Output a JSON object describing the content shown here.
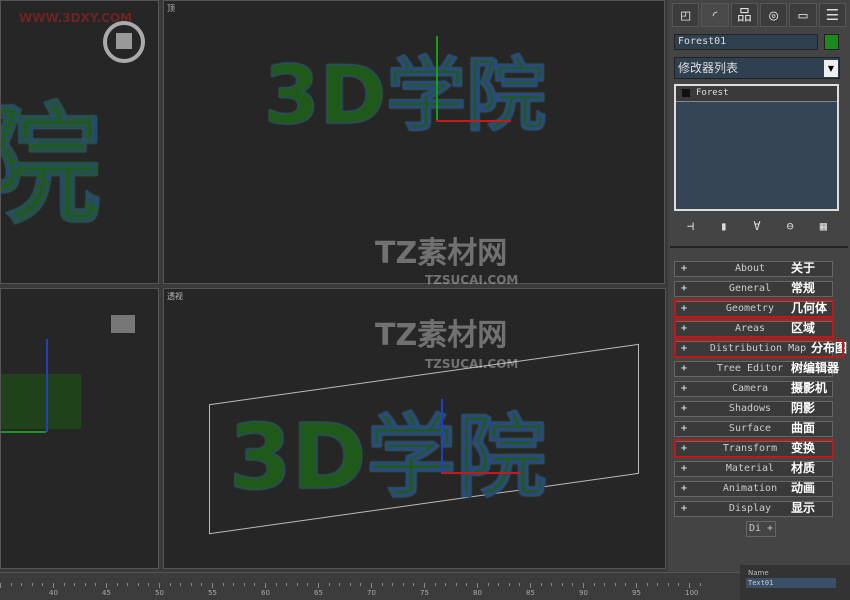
{
  "viewports": {
    "top_left": {
      "label": "",
      "watermark": "WWW.3DXY.COM",
      "text": "院"
    },
    "top": {
      "label": "顶",
      "text": "3D学院"
    },
    "left": {
      "label": ""
    },
    "perspective": {
      "label": "透视",
      "text": "3D学院"
    },
    "overlay_watermark": {
      "brand": "TZ素材网",
      "url": "TZSUCAI.COM"
    }
  },
  "panel": {
    "tabs": [
      "create-icon",
      "modify-icon",
      "hierarchy-icon",
      "motion-icon",
      "display-icon",
      "utilities-icon"
    ],
    "object_name": "Forest01",
    "object_color": "#1a8a1a",
    "modifier_list": "修改器列表",
    "stack": [
      "Forest"
    ],
    "rollouts": [
      {
        "label": "About",
        "cn": "关于",
        "highlight": false
      },
      {
        "label": "General",
        "cn": "常规",
        "highlight": false
      },
      {
        "label": "Geometry",
        "cn": "几何体",
        "highlight": true
      },
      {
        "label": "Areas",
        "cn": "区域",
        "highlight": true
      },
      {
        "label": "Distribution Map",
        "cn": "分布图",
        "highlight": true
      },
      {
        "label": "Tree Editor",
        "cn": "树编辑器",
        "highlight": false
      },
      {
        "label": "Camera",
        "cn": "摄影机",
        "highlight": false
      },
      {
        "label": "Shadows",
        "cn": "阴影",
        "highlight": false
      },
      {
        "label": "Surface",
        "cn": "曲面",
        "highlight": false
      },
      {
        "label": "Transform",
        "cn": "变换",
        "highlight": true
      },
      {
        "label": "Material",
        "cn": "材质",
        "highlight": false
      },
      {
        "label": "Animation",
        "cn": "动画",
        "highlight": false
      },
      {
        "label": "Display",
        "cn": "显示",
        "highlight": false
      }
    ],
    "partial_button": "Di"
  },
  "timeline": {
    "ticks": [
      "40",
      "45",
      "50",
      "55",
      "60",
      "65",
      "70",
      "75",
      "80",
      "85",
      "90",
      "95",
      "100"
    ]
  },
  "name_panel": {
    "label": "Name",
    "value": "Text01"
  }
}
